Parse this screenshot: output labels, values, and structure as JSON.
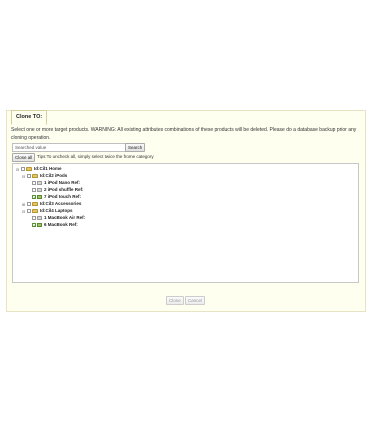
{
  "dialog": {
    "legend": "Clone TO:",
    "warning": "Select one or more target products. WARNING: All existing attributes combinations of these products will be deleted. Please do a database backup prior any cloning operation."
  },
  "search": {
    "value": "Searched value",
    "button_label": "Search"
  },
  "toolbar": {
    "close_all_label": "Close all",
    "tips": "Tips:To uncheck all, simply select twice the frome category"
  },
  "tree": {
    "nodes": [
      {
        "label": "Id:Cil1 Home",
        "checked": false,
        "type": "folder"
      },
      {
        "label": "Id:Cil2 iPods",
        "checked": false,
        "type": "folder"
      },
      {
        "label": "1 iPod Nano Ref:",
        "checked": false,
        "type": "item"
      },
      {
        "label": "2 iPod shuffle Ref:",
        "checked": false,
        "type": "item"
      },
      {
        "label": "7 iPod touch Ref:",
        "checked": true,
        "type": "item"
      },
      {
        "label": "Id:Cil3 Accessories",
        "checked": false,
        "type": "folder"
      },
      {
        "label": "Id:Cil4 Laptops",
        "checked": false,
        "type": "folder"
      },
      {
        "label": "1 MacBook Air Ref:",
        "checked": false,
        "type": "item"
      },
      {
        "label": "6 MacBook Ref:",
        "checked": true,
        "type": "item"
      }
    ]
  },
  "actions": {
    "clone_label": "Clone",
    "cancel_label": "Cancel"
  }
}
